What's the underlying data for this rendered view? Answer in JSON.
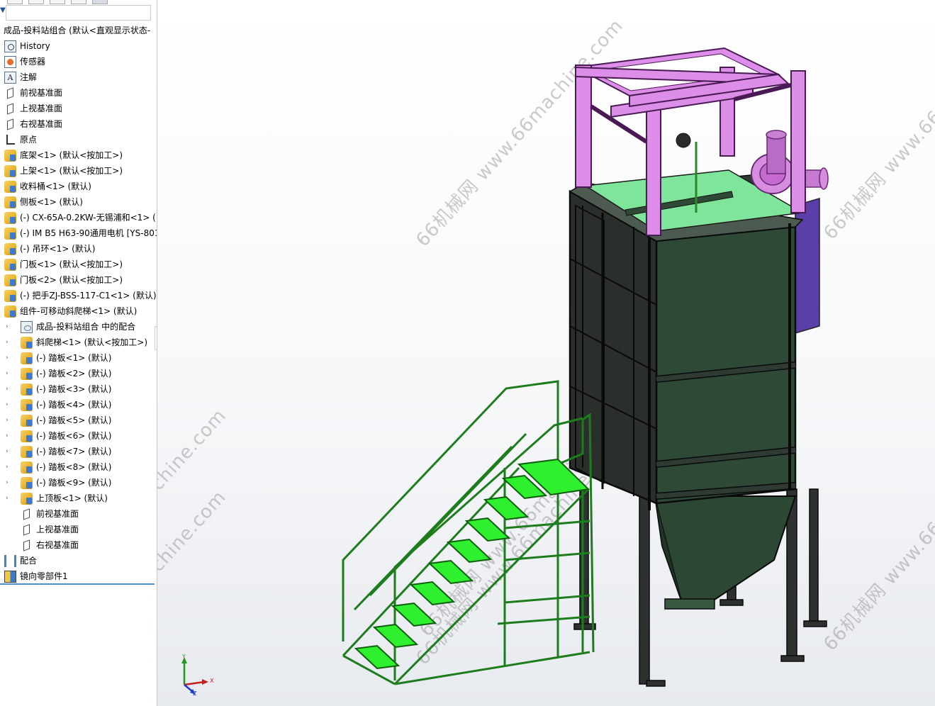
{
  "feature_tree": {
    "root_label": "成品-投料站组合 (默认<直观显示状态-",
    "items": [
      {
        "label": "History",
        "icon": "history-icon"
      },
      {
        "label": "传感器",
        "icon": "sensor-icon"
      },
      {
        "label": "注解",
        "icon": "annotation-icon"
      },
      {
        "label": "前视基准面",
        "icon": "plane-icon"
      },
      {
        "label": "上视基准面",
        "icon": "plane-icon"
      },
      {
        "label": "右视基准面",
        "icon": "plane-icon"
      },
      {
        "label": "原点",
        "icon": "origin-icon"
      },
      {
        "label": "底架<1> (默认<按加工>)",
        "icon": "part-icon"
      },
      {
        "label": "上架<1> (默认<按加工>)",
        "icon": "part-icon"
      },
      {
        "label": "收料桶<1> (默认)",
        "icon": "part-icon"
      },
      {
        "label": "侧板<1> (默认)",
        "icon": "part-icon"
      },
      {
        "label": "(-) CX-65A-0.2KW-无锡浦和<1> (",
        "icon": "part-icon"
      },
      {
        "label": "(-) IM B5 H63-90通用电机 [YS-801",
        "icon": "part-icon"
      },
      {
        "label": "(-) 吊环<1> (默认)",
        "icon": "part-icon"
      },
      {
        "label": "门板<1> (默认<按加工>)",
        "icon": "part-icon"
      },
      {
        "label": "门板<2> (默认<按加工>)",
        "icon": "part-icon"
      },
      {
        "label": "(-) 把手ZJ-BSS-117-C1<1> (默认)",
        "icon": "part-icon"
      },
      {
        "label": "组件-可移动斜爬梯<1> (默认)",
        "icon": "part-icon"
      }
    ],
    "sub_items": [
      {
        "label": "成品-投料站组合 中的配合",
        "icon": "mate-folder-icon"
      },
      {
        "label": "斜爬梯<1> (默认<按加工>)",
        "icon": "part-icon"
      },
      {
        "label": "(-) 踏板<1> (默认)",
        "icon": "part-icon"
      },
      {
        "label": "(-) 踏板<2> (默认)",
        "icon": "part-icon"
      },
      {
        "label": "(-) 踏板<3> (默认)",
        "icon": "part-icon"
      },
      {
        "label": "(-) 踏板<4> (默认)",
        "icon": "part-icon"
      },
      {
        "label": "(-) 踏板<5> (默认)",
        "icon": "part-icon"
      },
      {
        "label": "(-) 踏板<6> (默认)",
        "icon": "part-icon"
      },
      {
        "label": "(-) 踏板<7> (默认)",
        "icon": "part-icon"
      },
      {
        "label": "(-) 踏板<8> (默认)",
        "icon": "part-icon"
      },
      {
        "label": "(-) 踏板<9> (默认)",
        "icon": "part-icon"
      },
      {
        "label": "上顶板<1> (默认)",
        "icon": "part-icon"
      },
      {
        "label": "前视基准面",
        "icon": "plane-icon"
      },
      {
        "label": "上视基准面",
        "icon": "plane-icon"
      },
      {
        "label": "右视基准面",
        "icon": "plane-icon"
      }
    ],
    "tail_items": [
      {
        "label": "配合",
        "icon": "mates-icon"
      },
      {
        "label": "镜向零部件1",
        "icon": "mirror-component-icon"
      }
    ]
  },
  "viewport": {
    "watermarks": [
      "66机械网 www.66machine.com"
    ],
    "triad_labels": {
      "x": "X",
      "y": "Y",
      "z": "Z"
    },
    "colors": {
      "frame_top": "#d98ce6",
      "hopper_body": "#2f4a35",
      "ladder": "#1f9a1f",
      "steps": "#2ef02e",
      "blower": "#d78ee0",
      "side_panel": "#5a3fa8"
    }
  }
}
